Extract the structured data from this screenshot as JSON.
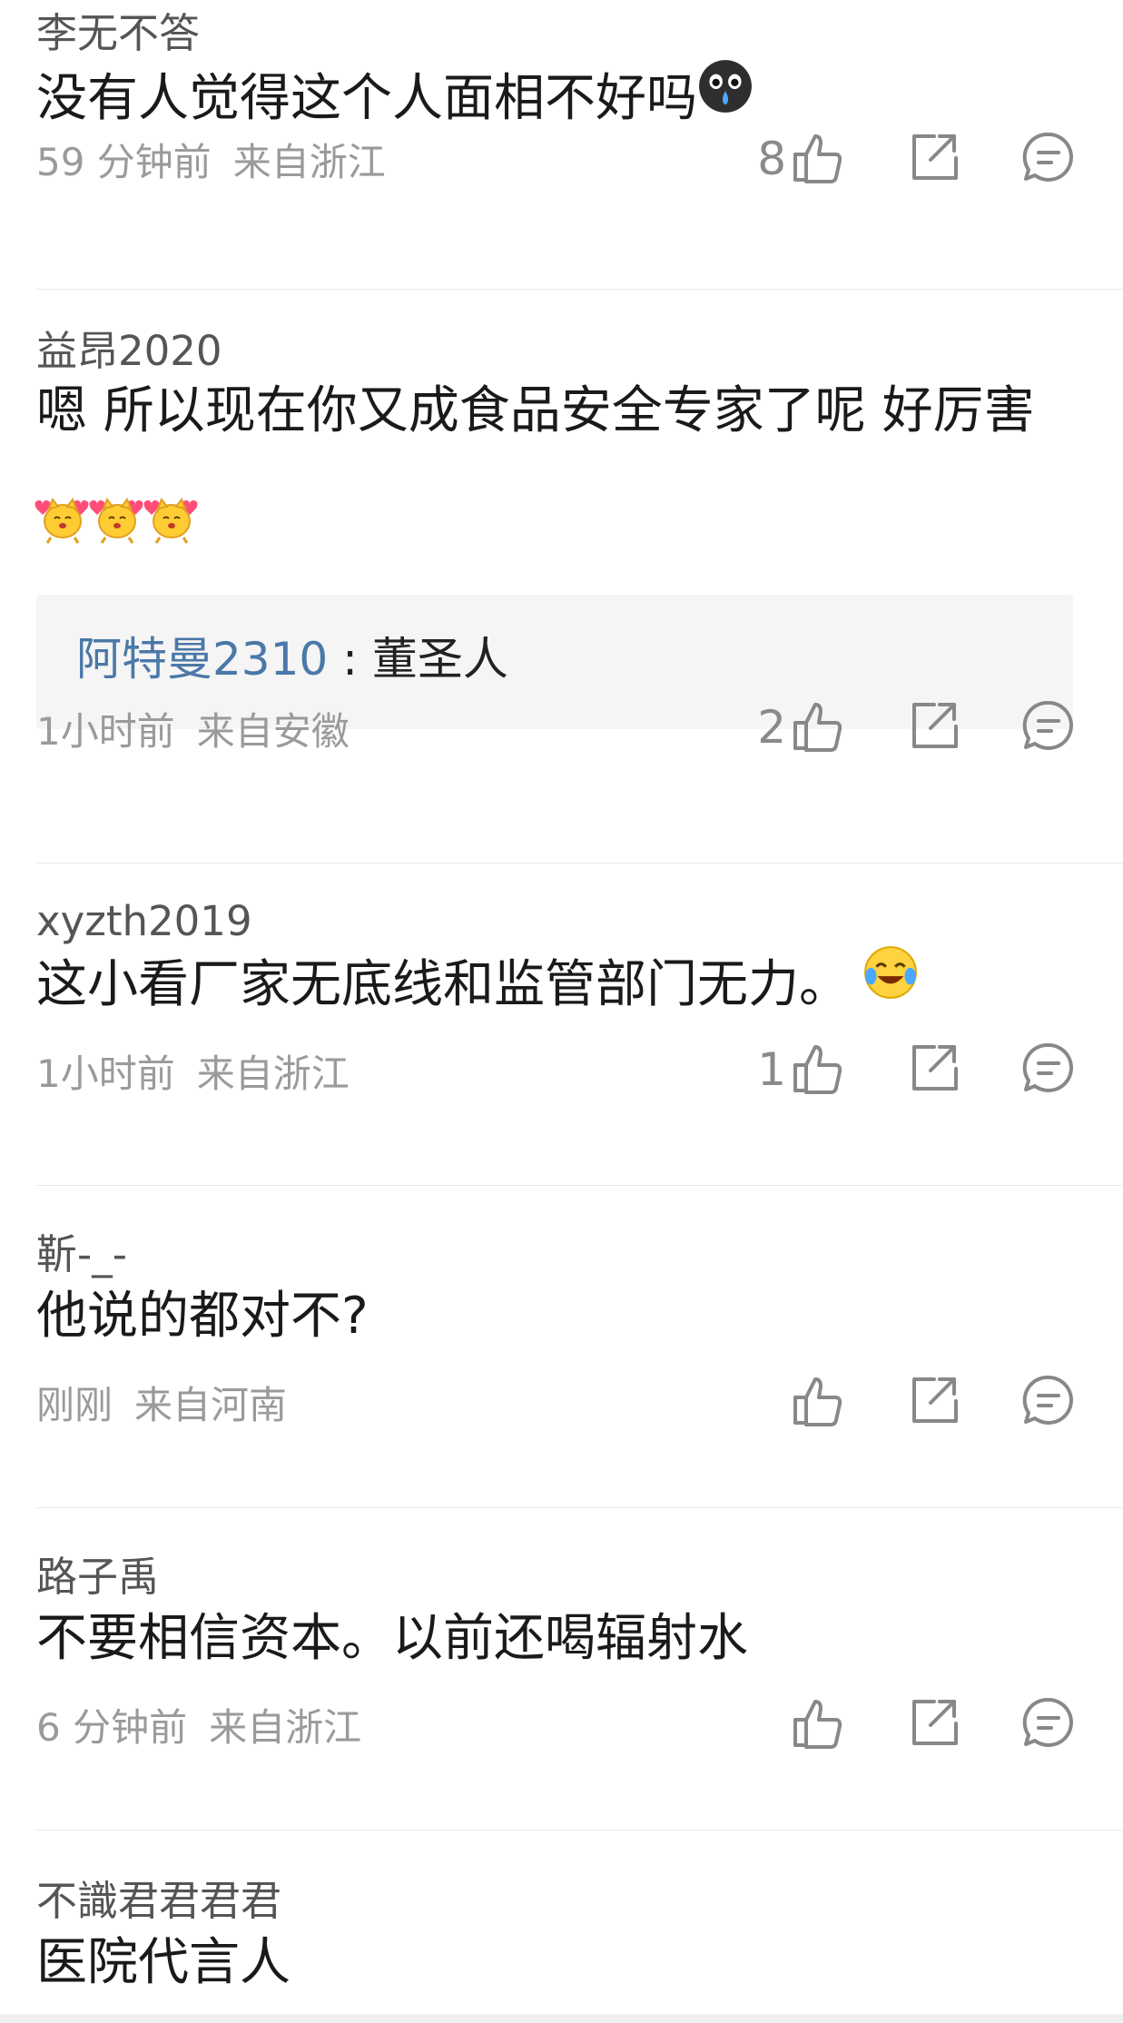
{
  "comments": [
    {
      "username": "李无不答",
      "text_lines": [
        "没有人觉得这个人面相不好吗"
      ],
      "emoji": "crying-face-emoji",
      "time": "59 分钟前",
      "location": "来自浙江",
      "likes": "8"
    },
    {
      "username": "益昂2020",
      "text_lines": [
        "嗯 所以现在你又成食品安全专家了呢 好厉害"
      ],
      "emoji": "hamster-hearts-emoji",
      "reply": {
        "author": "阿特曼2310",
        "separator": " : ",
        "text": "董圣人"
      },
      "time": "1小时前",
      "location": "来自安徽",
      "likes": "2"
    },
    {
      "username": "xyzth2019",
      "text_lines": [
        "这小看厂家无底线和监管部门无力。"
      ],
      "emoji": "laughing-tears-emoji",
      "time": "1小时前",
      "location": "来自浙江",
      "likes": "1"
    },
    {
      "username": "靳-_-",
      "text_lines": [
        "他说的都对不?"
      ],
      "time": "刚刚",
      "location": "来自河南",
      "likes": ""
    },
    {
      "username": "路子禹",
      "text_lines": [
        "不要相信资本。以前还喝辐射水"
      ],
      "time": "6 分钟前",
      "location": "来自浙江",
      "likes": ""
    },
    {
      "username": "不識君君君君",
      "text_lines": [
        "医院代言人"
      ],
      "time": "",
      "location": "",
      "likes": ""
    }
  ],
  "icons": {
    "like": "thumbs-up-icon",
    "share": "share-icon",
    "reply": "comment-icon"
  },
  "colors": {
    "reply_author": "#4a78a8",
    "meta": "#9a9a9a",
    "reply_bg": "#f5f5f5",
    "divider": "#e8e8e8"
  }
}
